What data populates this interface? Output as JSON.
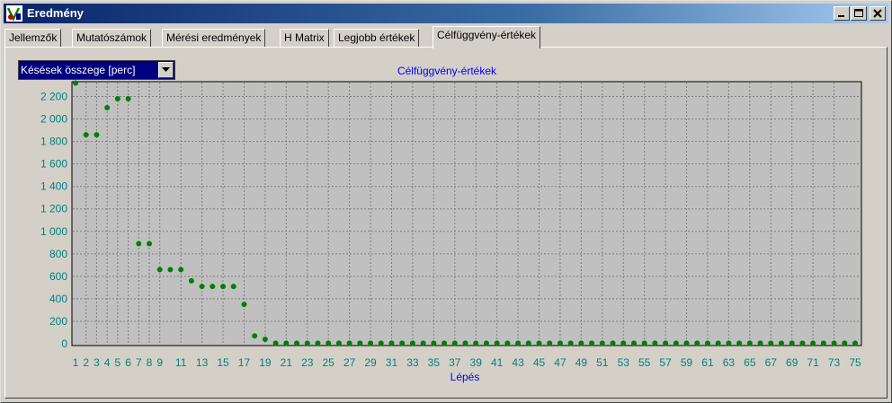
{
  "window": {
    "title": "Eredmény",
    "controls": {
      "minimize": "_",
      "maximize": "□",
      "close": "×"
    }
  },
  "tabs": [
    {
      "label": "Jellemzők"
    },
    {
      "label": "Mutatószámok"
    },
    {
      "label": "Mérési eredmények"
    },
    {
      "label": "H Matrix"
    },
    {
      "label": "Legjobb értékek"
    },
    {
      "label": "Célfüggvény-értékek",
      "active": true
    }
  ],
  "dropdown": {
    "selected": "Késések összege [perc]"
  },
  "colors": {
    "axis_text": "#008080",
    "title": "#0000ff",
    "marker": "#008000",
    "grid": "#808080"
  },
  "chart_data": {
    "type": "scatter",
    "title": "Célfüggvény-értékek",
    "xlabel": "Lépés",
    "ylabel": "",
    "xlim": [
      1,
      75
    ],
    "ylim": [
      0,
      2300
    ],
    "yticks": [
      0,
      200,
      400,
      600,
      800,
      1000,
      1200,
      1400,
      1600,
      1800,
      2000,
      2200
    ],
    "ytick_labels": [
      "0",
      "200",
      "400",
      "600",
      "800",
      "1 000",
      "1 200",
      "1 400",
      "1 600",
      "1 800",
      "2 000",
      "2 200"
    ],
    "xtick_labels": [
      "1",
      "2",
      "3",
      "4",
      "5",
      "6",
      "7",
      "8",
      "9",
      "11",
      "13",
      "15",
      "17",
      "19",
      "21",
      "23",
      "25",
      "27",
      "29",
      "31",
      "33",
      "35",
      "37",
      "39",
      "41",
      "43",
      "45",
      "47",
      "49",
      "51",
      "53",
      "55",
      "57",
      "59",
      "61",
      "63",
      "65",
      "67",
      "69",
      "71",
      "73",
      "75"
    ],
    "grid": true,
    "x": [
      1,
      2,
      3,
      4,
      5,
      6,
      7,
      8,
      9,
      10,
      11,
      12,
      13,
      14,
      15,
      16,
      17,
      18,
      19,
      20,
      21,
      22,
      23,
      24,
      25,
      26,
      27,
      28,
      29,
      30,
      31,
      32,
      33,
      34,
      35,
      36,
      37,
      38,
      39,
      40,
      41,
      42,
      43,
      44,
      45,
      46,
      47,
      48,
      49,
      50,
      51,
      52,
      53,
      54,
      55,
      56,
      57,
      58,
      59,
      60,
      61,
      62,
      63,
      64,
      65,
      66,
      67,
      68,
      69,
      70,
      71,
      72,
      73,
      74,
      75
    ],
    "y": [
      2320,
      1860,
      1860,
      2100,
      2180,
      2180,
      890,
      890,
      660,
      660,
      660,
      560,
      510,
      510,
      510,
      510,
      350,
      70,
      40,
      5,
      5,
      5,
      5,
      5,
      5,
      5,
      5,
      5,
      5,
      5,
      5,
      5,
      5,
      5,
      5,
      5,
      5,
      5,
      5,
      5,
      5,
      5,
      5,
      5,
      5,
      5,
      5,
      5,
      5,
      5,
      5,
      5,
      5,
      5,
      5,
      5,
      5,
      5,
      5,
      5,
      5,
      5,
      5,
      5,
      5,
      5,
      5,
      5,
      5,
      5,
      5,
      5,
      5,
      5,
      5
    ]
  }
}
